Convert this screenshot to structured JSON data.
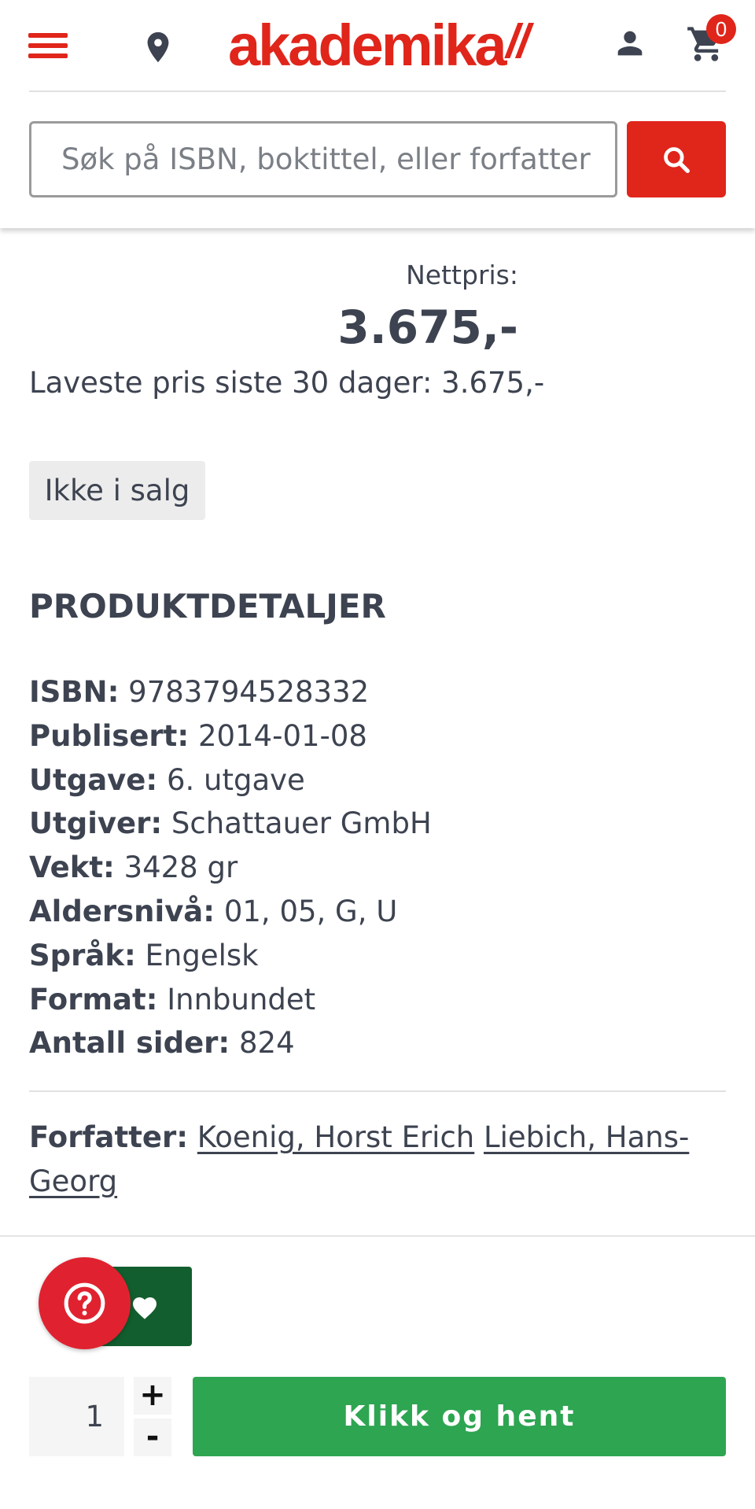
{
  "header": {
    "logo_text": "akademika",
    "logo_ticks": "//",
    "cart_count": "0",
    "search": {
      "placeholder": "Søk på ISBN, boktittel, eller forfatter"
    }
  },
  "price": {
    "label": "Nettpris:",
    "value": "3.675,-",
    "lowest_30_days": "Laveste pris siste 30 dager: 3.675,-"
  },
  "status_badge": "Ikke i salg",
  "details": {
    "heading": "PRODUKTDETALJER",
    "rows": [
      {
        "label": "ISBN:",
        "value": "9783794528332"
      },
      {
        "label": "Publisert:",
        "value": "2014-01-08"
      },
      {
        "label": "Utgave:",
        "value": "6. utgave"
      },
      {
        "label": "Utgiver:",
        "value": "Schattauer GmbH"
      },
      {
        "label": "Vekt:",
        "value": "3428 gr"
      },
      {
        "label": "Aldersnivå:",
        "value": "01, 05, G, U"
      },
      {
        "label": "Språk:",
        "value": "Engelsk"
      },
      {
        "label": "Format:",
        "value": "Innbundet"
      },
      {
        "label": "Antall sider:",
        "value": "824"
      }
    ]
  },
  "authors": {
    "label": "Forfatter:",
    "names": [
      "Koenig, Horst Erich",
      "Liebich, Hans-Georg"
    ]
  },
  "actions": {
    "quantity": "1",
    "plus": "+",
    "minus": "-",
    "pickup_label": "Klikk og hent"
  },
  "colors": {
    "brand_red": "#e0251b",
    "pickup_green": "#2ea551",
    "wishlist_green": "#125e2e",
    "text": "#3d4350"
  }
}
